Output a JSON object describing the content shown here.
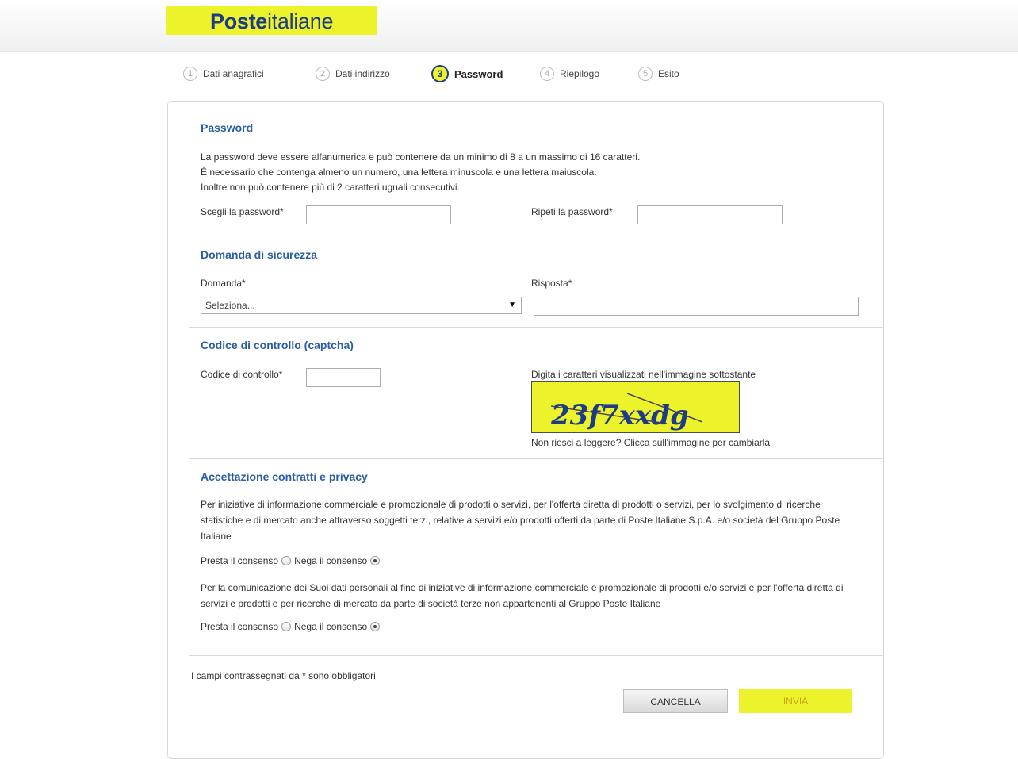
{
  "header": {
    "logo_bold": "Poste",
    "logo_light": "italiane",
    "brand_color": "#ecf32a",
    "brand_text_color": "#1d3b89"
  },
  "steps": [
    {
      "num": "1",
      "label": "Dati anagrafici"
    },
    {
      "num": "2",
      "label": "Dati indirizzo"
    },
    {
      "num": "3",
      "label": "Password",
      "active": true
    },
    {
      "num": "4",
      "label": "Riepilogo"
    },
    {
      "num": "5",
      "label": "Esito"
    }
  ],
  "password": {
    "title": "Password",
    "rules": [
      "La password deve essere alfanumerica e può contenere da un minimo di 8 a un massimo di 16 caratteri.",
      "È necessario che contenga almeno un numero, una lettera minuscola e una lettera maiuscola.",
      "Inoltre non può contenere più di 2 caratteri uguali consecutivi."
    ],
    "choose_label": "Scegli la password*",
    "choose_value": "",
    "repeat_label": "Ripeti la password*",
    "repeat_value": ""
  },
  "security": {
    "title": "Domanda di sicurezza",
    "question_label": "Domanda*",
    "question_selected": "Seleziona...",
    "answer_label": "Risposta*",
    "answer_value": ""
  },
  "captcha": {
    "title": "Codice di controllo (captcha)",
    "code_label": "Codice di controllo*",
    "code_value": "",
    "hint": "Digita i caratteri visualizzati nell'immagine sottostante",
    "image_text": "23f7xxdg",
    "refresh_hint": "Non riesci a leggere? Clicca sull'immagine per cambiarla"
  },
  "privacy": {
    "title": "Accettazione contratti e privacy",
    "consent1_text": "Per iniziative di informazione commerciale e promozionale di prodotti o servizi, per l'offerta diretta di prodotti o servizi, per lo svolgimento di ricerche statistiche e di mercato anche attraverso soggetti terzi, relative a servizi e/o prodotti offerti da parte di Poste Italiane S.p.A. e/o società del Gruppo Poste Italiane",
    "consent2_text": "Per la comunicazione dei Suoi dati personali al fine di iniziative di informazione commerciale e promozionale di prodotti e/o servizi e per l'offerta diretta di servizi e prodotti e per ricerche di mercato da parte di società terze non appartenenti al Gruppo Poste Italiane",
    "give_label": "Presta il consenso",
    "deny_label": "Nega il consenso",
    "consent1_selected": "deny",
    "consent2_selected": "deny"
  },
  "footer": {
    "required_note": "I campi contrassegnati da * sono obbligatori",
    "cancel_label": "CANCELLA",
    "send_label": "INVIA"
  }
}
